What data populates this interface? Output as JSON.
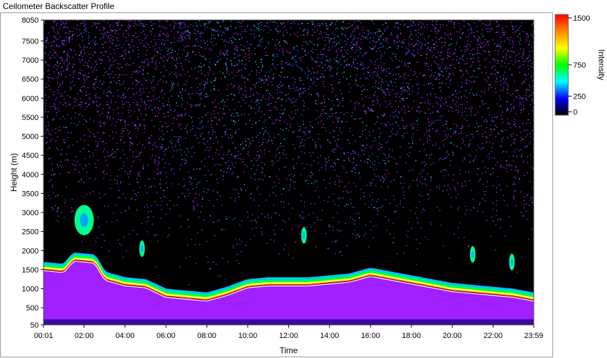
{
  "window": {
    "title": "Ceilometer Backscatter Profile"
  },
  "chart_data": {
    "type": "heatmap",
    "title": "Ceilometer Backscatter Profile",
    "xlabel": "Time",
    "ylabel": "Height (m)",
    "x_ticks": [
      "00:01",
      "02:00",
      "04:00",
      "06:00",
      "08:00",
      "10:00",
      "12:00",
      "14:00",
      "16:00",
      "18:00",
      "20:00",
      "22:00",
      "23:59"
    ],
    "y_ticks": [
      50,
      500,
      1000,
      1500,
      2000,
      2500,
      3000,
      3500,
      4000,
      4500,
      5000,
      5500,
      6000,
      6500,
      7000,
      7500,
      8050
    ],
    "xlim": [
      "00:01",
      "23:59"
    ],
    "ylim": [
      50,
      8050
    ],
    "colorbar": {
      "label": "Intensity",
      "ticks": [
        0,
        250,
        750,
        1500
      ],
      "range": [
        0,
        1500
      ],
      "colors": [
        "#000000",
        "#0000ff",
        "#00ffff",
        "#00ff00",
        "#ffff00",
        "#ff8800",
        "#ff0000"
      ]
    },
    "layers": {
      "mixing_layer_top": [
        {
          "time": "00:01",
          "height": 1600
        },
        {
          "time": "01:00",
          "height": 1550
        },
        {
          "time": "01:30",
          "height": 1850
        },
        {
          "time": "02:30",
          "height": 1800
        },
        {
          "time": "03:00",
          "height": 1350
        },
        {
          "time": "04:00",
          "height": 1200
        },
        {
          "time": "05:00",
          "height": 1150
        },
        {
          "time": "06:00",
          "height": 900
        },
        {
          "time": "07:00",
          "height": 850
        },
        {
          "time": "08:00",
          "height": 800
        },
        {
          "time": "09:00",
          "height": 950
        },
        {
          "time": "10:00",
          "height": 1150
        },
        {
          "time": "11:00",
          "height": 1200
        },
        {
          "time": "12:00",
          "height": 1200
        },
        {
          "time": "13:00",
          "height": 1200
        },
        {
          "time": "14:00",
          "height": 1250
        },
        {
          "time": "15:00",
          "height": 1300
        },
        {
          "time": "16:00",
          "height": 1450
        },
        {
          "time": "17:00",
          "height": 1350
        },
        {
          "time": "18:00",
          "height": 1250
        },
        {
          "time": "19:00",
          "height": 1150
        },
        {
          "time": "20:00",
          "height": 1050
        },
        {
          "time": "21:00",
          "height": 1000
        },
        {
          "time": "22:00",
          "height": 950
        },
        {
          "time": "23:00",
          "height": 900
        },
        {
          "time": "23:59",
          "height": 800
        }
      ],
      "residual_clouds": [
        {
          "time": "02:00",
          "height": 2800
        },
        {
          "time": "04:50",
          "height": 2050
        },
        {
          "time": "12:45",
          "height": 2400
        },
        {
          "time": "21:00",
          "height": 1900
        },
        {
          "time": "22:55",
          "height": 1700
        }
      ]
    }
  }
}
